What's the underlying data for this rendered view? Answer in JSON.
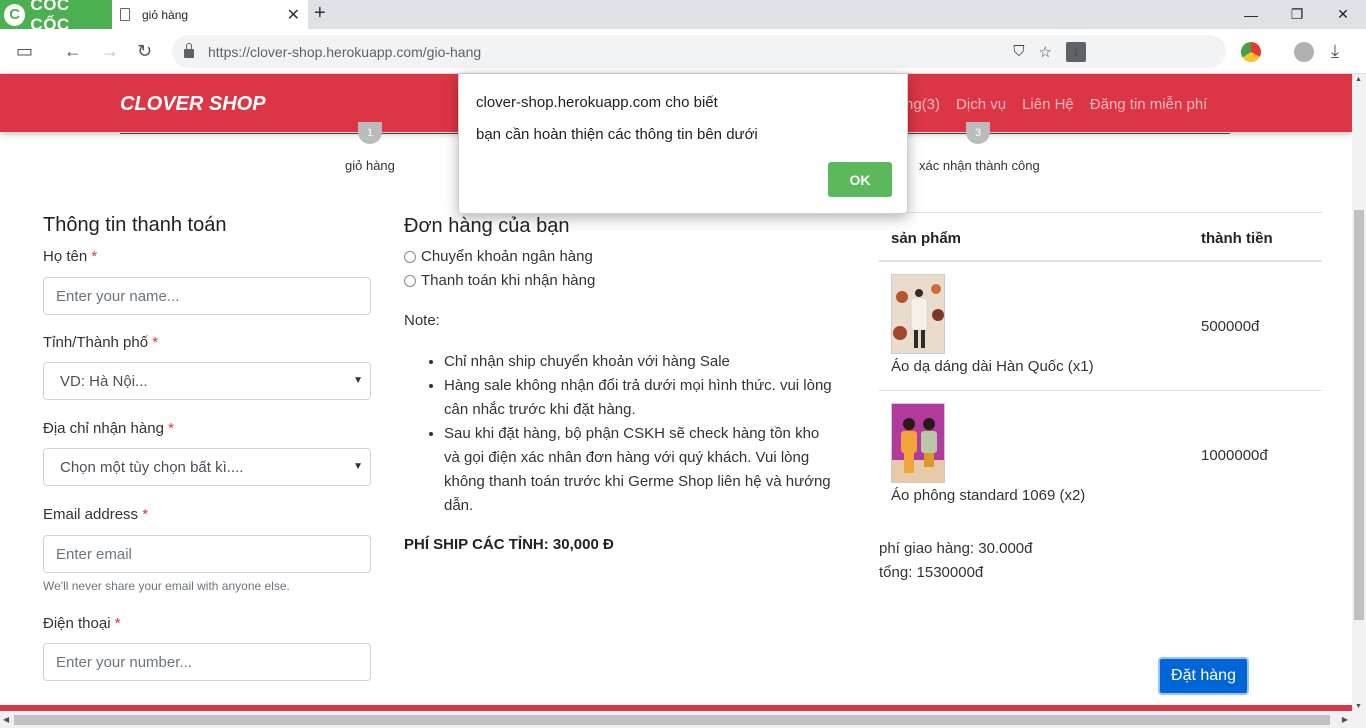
{
  "browser": {
    "name": "CỐC CỐC",
    "tab_title": "giỏ hàng",
    "url": "https://clover-shop.herokuapp.com/gio-hang"
  },
  "site": {
    "brand": "CLOVER SHOP",
    "nav": [
      "ng(3)",
      "Dịch vụ",
      "Liên Hệ",
      "Đăng tin miễn phí"
    ],
    "accent_color": "#dc3545"
  },
  "steps": {
    "step1_number": "1",
    "step1_label": "giỏ hàng",
    "step3_number": "3",
    "step3_label": "xác nhận thành công"
  },
  "billing": {
    "title": "Thông tin thanh toán",
    "name_label": "Họ tên",
    "name_placeholder": "Enter your name...",
    "city_label": "Tỉnh/Thành phố",
    "city_value": "VD: Hà Nội...",
    "address_label": "Địa chỉ nhận hàng",
    "address_value": "Chọn một tùy chọn bất kì....",
    "email_label": "Email address",
    "email_placeholder": "Enter email",
    "email_help": "We'll never share your email with anyone else.",
    "phone_label": "Điện thoại",
    "phone_placeholder": "Enter your number...",
    "required_mark": "*"
  },
  "order": {
    "title": "Đơn hàng của bạn",
    "payment_options": [
      "Chuyển khoản ngân hàng",
      "Thanh toán khi nhận hàng"
    ],
    "note_label": "Note:",
    "notes": [
      "Chỉ nhận ship chuyển khoản với hàng Sale",
      "Hàng sale không nhận đổi trả dưới mọi hình thức. vui lòng cân nhắc trước khi đặt hàng.",
      "Sau khi đặt hàng, bộ phận CSKH sẽ check hàng tồn kho và gọi điện xác nhân đơn hàng với quý khách. Vui lòng không thanh toán trước khi Germe Shop liên hệ và hướng dẫn."
    ],
    "ship_fee": "PHÍ SHIP CÁC TỈNH: 30,000 Đ"
  },
  "cart": {
    "headers": [
      "sản phẩm",
      "thành tiền"
    ],
    "items": [
      {
        "name": "Áo dạ dáng dài Hàn Quốc (x1)",
        "price": "500000đ"
      },
      {
        "name": "Áo phông standard 1069 (x2)",
        "price": "1000000đ"
      }
    ],
    "shipping": "phí giao hàng: 30.000đ",
    "total": "tổng: 1530000đ",
    "order_button": "Đặt hàng"
  },
  "dialog": {
    "origin": "clover-shop.herokuapp.com cho biết",
    "message": "bạn cần hoàn thiện các thông tin bên dưới",
    "ok_label": "OK"
  }
}
